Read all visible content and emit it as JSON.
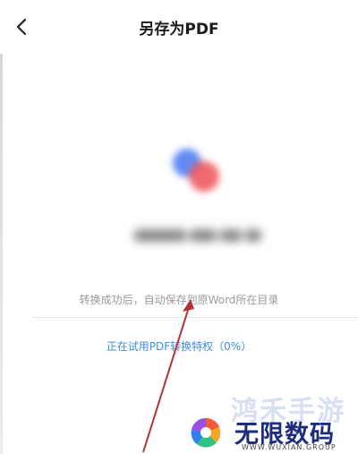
{
  "header": {
    "title": "另存为PDF",
    "back_icon": "chevron-left-icon"
  },
  "main": {
    "hint": "转换成功后，自动保存到原Word所在目录",
    "trial_link": "正在试用PDF转换特权（0%）",
    "trial_progress_percent": 0
  },
  "watermark": {
    "top_text": "鸿禾手游",
    "brand": "无限数码",
    "url": "WWW.WUXIAN.GROUP"
  },
  "colors": {
    "accent": "#3c8ee6",
    "logo_blue": "#4f7ef2",
    "logo_red": "#ef5a5f",
    "arrow": "#b3323a"
  }
}
